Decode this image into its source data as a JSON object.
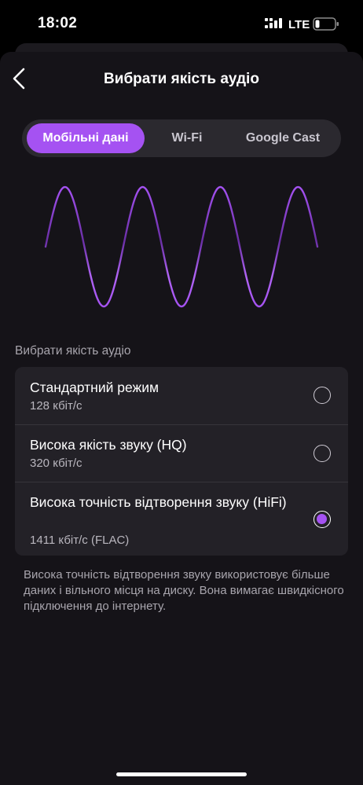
{
  "status_bar": {
    "time": "18:02",
    "network": "LTE",
    "icons": [
      "signal-icon",
      "battery-icon"
    ]
  },
  "header": {
    "title": "Вибрати якість аудіо",
    "back_icon": "chevron-left-icon"
  },
  "tabs": [
    {
      "label": "Мобільні дані",
      "active": true
    },
    {
      "label": "Wi-Fi",
      "active": false
    },
    {
      "label": "Google Cast",
      "active": false
    }
  ],
  "section_label": "Вибрати якість аудіо",
  "options": [
    {
      "title": "Стандартний режим",
      "subtitle": "128 кбіт/с",
      "selected": false
    },
    {
      "title": "Висока якість звуку (HQ)",
      "subtitle": "320 кбіт/с",
      "selected": false
    },
    {
      "title": "Висока точність відтворення звуку (HiFi)",
      "subtitle": "1411 кбіт/с (FLAC)",
      "selected": true
    }
  ],
  "description": "Висока точність відтворення звуку використовує більше даних і вільного місця на диску. Вона вимагає швидкісного підключення до інтернету.",
  "colors": {
    "accent": "#a552f2",
    "background": "#151318",
    "card": "#232127",
    "wave_dark": "#4b2470",
    "wave_light": "#a552f2"
  }
}
